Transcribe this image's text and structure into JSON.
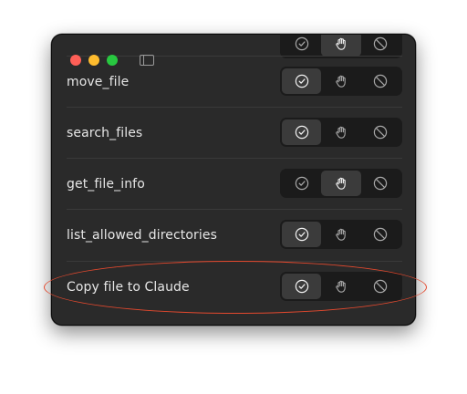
{
  "window": {
    "title_controls": [
      "close",
      "minimize",
      "zoom"
    ]
  },
  "tools": [
    {
      "label": "",
      "state": "ask"
    },
    {
      "label": "move_file",
      "state": "allow"
    },
    {
      "label": "search_files",
      "state": "allow"
    },
    {
      "label": "get_file_info",
      "state": "ask"
    },
    {
      "label": "list_allowed_directories",
      "state": "allow"
    },
    {
      "label": "Copy file to Claude",
      "state": "allow"
    }
  ],
  "icons": {
    "allow": "check-circle-icon",
    "ask": "hand-icon",
    "deny": "block-icon"
  },
  "colors": {
    "annotation": "#e5492e",
    "window_bg": "#2a2a2a",
    "segment_bg": "#1b1b1b",
    "segment_active": "#3b3b3b"
  }
}
